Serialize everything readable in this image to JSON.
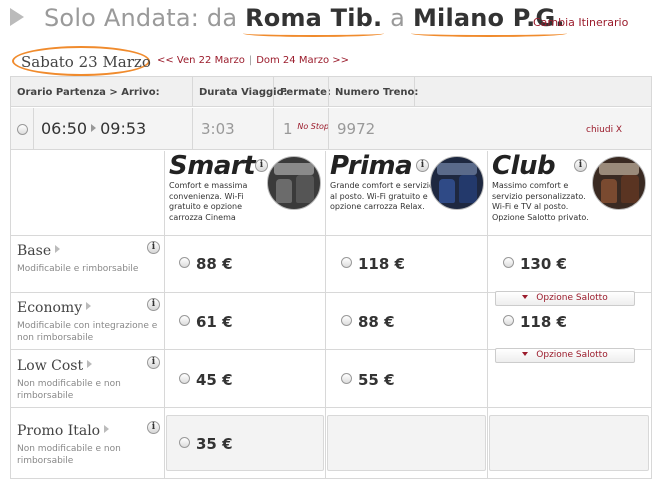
{
  "header": {
    "prefix": "Solo Andata: da",
    "origin": "Roma Tib.",
    "connector": "a",
    "destination": "Milano P.G.",
    "change_link": "Cambia Itinerario"
  },
  "date_bar": {
    "selected_date": "Sabato 23 Marzo",
    "prev_link": "<< Ven 22 Marzo",
    "separator": "|",
    "next_link": "Dom 24 Marzo >>"
  },
  "table": {
    "columns": [
      "Orario Partenza > Arrivo:",
      "Durata Viaggio:",
      "Fermate:",
      "Numero Treno:"
    ],
    "train": {
      "departure": "06:50",
      "arrival": "09:53",
      "duration": "3:03",
      "stops": "1",
      "stops_note": "No Stop",
      "train_number": "9972",
      "close_label": "chiudi X"
    }
  },
  "info_glyph": "i",
  "classes": [
    {
      "name": "Smart",
      "description": "Comfort e massima convenienza. Wi-Fi gratuito e opzione carrozza Cinema",
      "icon": "smart-seat-thumbnail"
    },
    {
      "name": "Prima",
      "description": "Grande comfort e servizio al posto. Wi-Fi gratuito e opzione carrozza Relax.",
      "icon": "prima-seat-thumbnail"
    },
    {
      "name": "Club",
      "description": "Massimo comfort e servizio personalizzato. Wi-Fi e TV al posto. Opzione Salotto privato.",
      "icon": "club-seat-thumbnail"
    }
  ],
  "fares": [
    {
      "name": "Base",
      "description": "Modificabile e rimborsabile",
      "prices": [
        "88 €",
        "118 €",
        "130 €"
      ]
    },
    {
      "name": "Economy",
      "description": "Modificabile con integrazione e non rimborsabile",
      "prices": [
        "61 €",
        "88 €",
        "118 €"
      ]
    },
    {
      "name": "Low Cost",
      "description": "Non modificabile e non rimborsabile",
      "prices": [
        "45 €",
        "55 €",
        ""
      ]
    },
    {
      "name": "Promo Italo",
      "description": "Non modificabile e non rimborsabile",
      "prices": [
        "35 €",
        "",
        ""
      ]
    }
  ],
  "salotto_option_label": "Opzione Salotto",
  "colors": {
    "accent": "#9b1c2c",
    "highlight": "#f08b2d"
  }
}
